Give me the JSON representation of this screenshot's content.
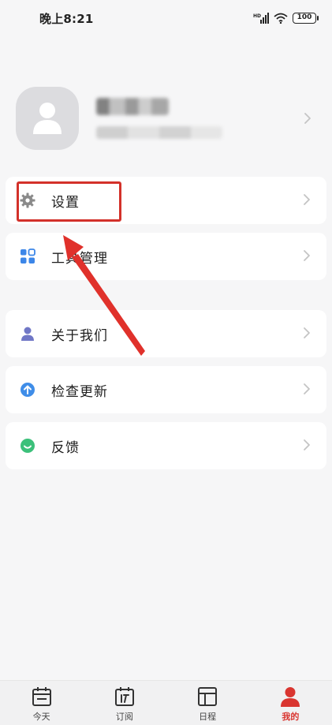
{
  "status_bar": {
    "time": "晚上8:21",
    "network_badge": "HD",
    "battery": "100"
  },
  "profile": {
    "avatar_icon": "person-icon",
    "name_blurred": true,
    "id_blurred": true
  },
  "menu": [
    {
      "label": "设置",
      "icon": "gear-icon"
    },
    {
      "label": "工具管理",
      "icon": "grid-icon"
    },
    {
      "label": "关于我们",
      "icon": "person-icon"
    },
    {
      "label": "检查更新",
      "icon": "upload-icon"
    },
    {
      "label": "反馈",
      "icon": "smile-icon"
    }
  ],
  "bottom_nav": [
    {
      "label": "今天",
      "icon": "calendar-today-icon",
      "active": false
    },
    {
      "label": "订阅",
      "icon": "subscribe-icon",
      "active": false
    },
    {
      "label": "日程",
      "icon": "schedule-layout-icon",
      "active": false
    },
    {
      "label": "我的",
      "icon": "profile-icon",
      "active": true
    }
  ],
  "colors": {
    "background": "#f6f6f7",
    "card": "#ffffff",
    "accent_red": "#d93530",
    "annotation_red": "#d3312a",
    "tool_icon_blue": "#3c86e8",
    "about_icon_indigo": "#7077c6",
    "update_icon_blue": "#3f8de8",
    "feedback_icon_green": "#3cc07a",
    "gear_gray": "#8a8a8a"
  }
}
